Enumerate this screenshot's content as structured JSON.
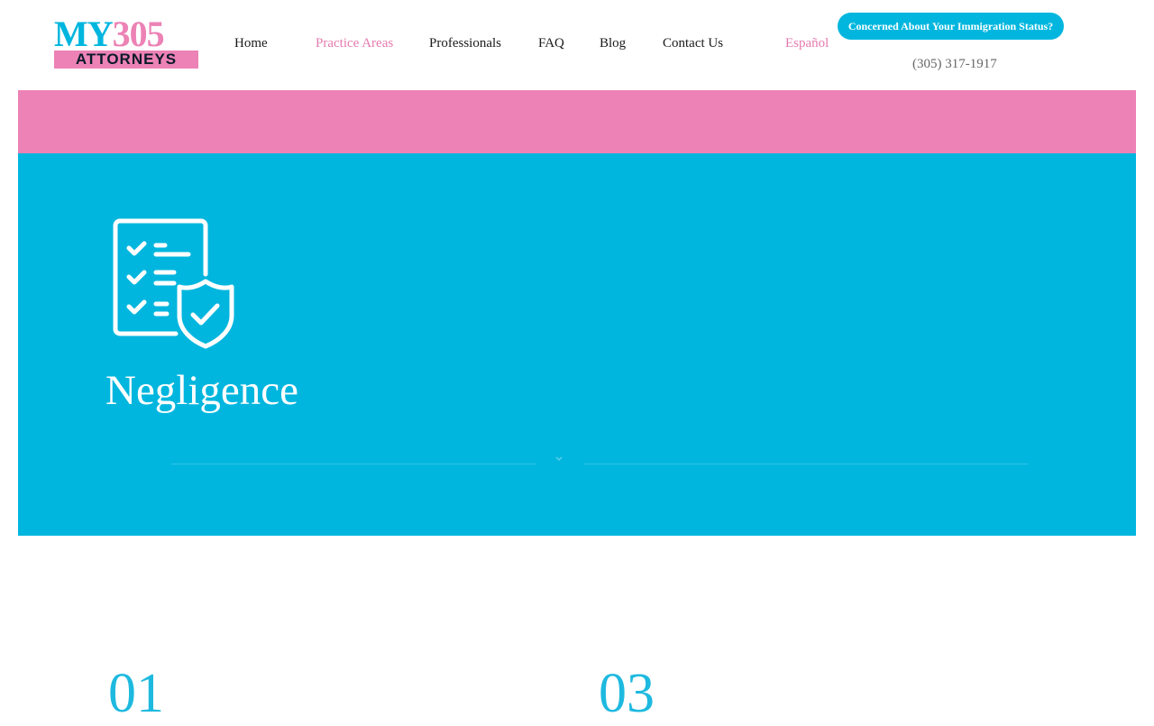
{
  "header": {
    "logo": {
      "line1_letters": "MY",
      "line1_number": "305",
      "line2": "ATTORNEYS"
    },
    "nav": [
      {
        "label": "Home"
      },
      {
        "label": "Practice Areas"
      },
      {
        "label": "Professionals"
      },
      {
        "label": "FAQ"
      },
      {
        "label": "Blog"
      },
      {
        "label": "Contact Us"
      },
      {
        "label": "Español"
      }
    ],
    "cta_label": "Concerned About Your Immigration Status?",
    "phone": "(305) 317-1917"
  },
  "hero": {
    "icon": "checklist-shield-icon",
    "title": "Negligence"
  },
  "steps": {
    "first": "01",
    "second": "03"
  },
  "colors": {
    "brand_blue": "#00b6de",
    "brand_pink": "#ec82b5",
    "text_dark": "#1a1a1a",
    "text_gray": "#666666"
  }
}
